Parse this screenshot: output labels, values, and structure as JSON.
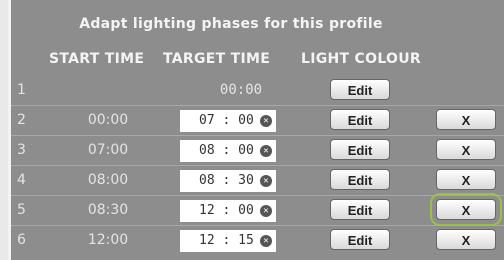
{
  "header": {
    "title": "Adapt lighting phases for this profile",
    "columns": [
      "START TIME",
      "TARGET TIME",
      "LIGHT COLOUR"
    ]
  },
  "rows": [
    {
      "num": "1",
      "start": "",
      "target": "00:00",
      "target_editable": false,
      "edit_label": "Edit",
      "delete_label": ""
    },
    {
      "num": "2",
      "start": "00:00",
      "target": "07 : 00",
      "target_editable": true,
      "edit_label": "Edit",
      "delete_label": "X"
    },
    {
      "num": "3",
      "start": "07:00",
      "target": "08 : 00",
      "target_editable": true,
      "edit_label": "Edit",
      "delete_label": "X"
    },
    {
      "num": "4",
      "start": "08:00",
      "target": "08 : 30",
      "target_editable": true,
      "edit_label": "Edit",
      "delete_label": "X"
    },
    {
      "num": "5",
      "start": "08:30",
      "target": "12 : 00",
      "target_editable": true,
      "edit_label": "Edit",
      "delete_label": "X"
    },
    {
      "num": "6",
      "start": "12:00",
      "target": "12 : 15",
      "target_editable": true,
      "edit_label": "Edit",
      "delete_label": "X"
    }
  ],
  "colors": {
    "panel_bg": "#8d8d8d",
    "focus_outline": "#98c04a"
  },
  "icons": {
    "clear": "clear-circle-icon"
  }
}
